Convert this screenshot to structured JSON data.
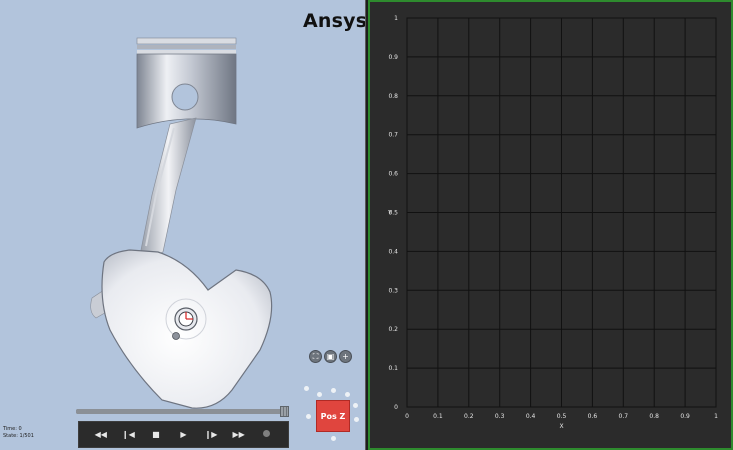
{
  "brand": {
    "name": "Ansys"
  },
  "viewport": {
    "status": {
      "time_text": "Time: 0",
      "state_text": "State: 1/501"
    },
    "view_tools": [
      {
        "name": "fit-view",
        "glyph": "⛶"
      },
      {
        "name": "view-mode",
        "glyph": "▣"
      },
      {
        "name": "zoom-in",
        "glyph": "+"
      }
    ],
    "orientation": {
      "label": "Pos Z",
      "accent": "#e0453e"
    },
    "slider": {
      "progress": 0.97
    },
    "playback": [
      {
        "name": "rewind",
        "glyph": "◀◀"
      },
      {
        "name": "step-back",
        "glyph": "❙◀"
      },
      {
        "name": "stop",
        "glyph": "■"
      },
      {
        "name": "play",
        "glyph": "▶"
      },
      {
        "name": "step-forward",
        "glyph": "❙▶"
      },
      {
        "name": "fast-forward",
        "glyph": "▶▶"
      },
      {
        "name": "record",
        "glyph": ""
      }
    ]
  },
  "chart_data": {
    "type": "line",
    "title": "",
    "xlabel": "X",
    "ylabel": "Y",
    "xlim": [
      0,
      1
    ],
    "ylim": [
      0,
      1
    ],
    "xticks": [
      "0",
      "0.1",
      "0.2",
      "0.3",
      "0.4",
      "0.5",
      "0.6",
      "0.7",
      "0.8",
      "0.9",
      "1"
    ],
    "yticks": [
      "0",
      "0.1",
      "0.2",
      "0.3",
      "0.4",
      "0.5",
      "0.6",
      "0.7",
      "0.8",
      "0.9",
      "1"
    ],
    "grid": true,
    "series": [],
    "colors": {
      "background": "#2b2b2b",
      "grid": "#111111",
      "text": "#e6e6e6",
      "border": "#2e8b2e"
    }
  }
}
